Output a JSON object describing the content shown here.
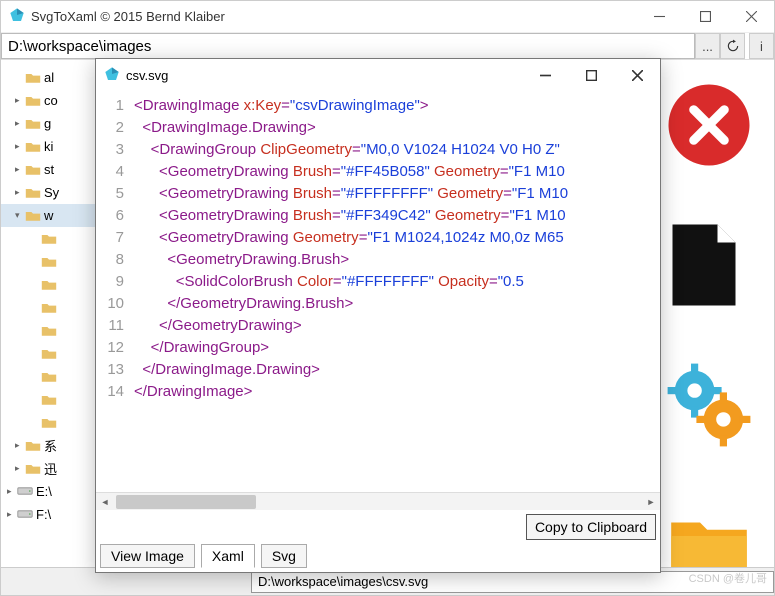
{
  "main": {
    "title": "SvgToXaml   © 2015 Bernd Klaiber",
    "path": "D:\\workspace\\images"
  },
  "toolbar": {
    "browse": "...",
    "info": "i"
  },
  "tree": {
    "items": [
      {
        "label": "al",
        "exp": false
      },
      {
        "label": "co",
        "exp": true
      },
      {
        "label": "g",
        "exp": true
      },
      {
        "label": "ki",
        "exp": true
      },
      {
        "label": "st",
        "exp": true
      },
      {
        "label": "Sy",
        "exp": true
      },
      {
        "label": "w",
        "exp": true,
        "sel": true,
        "child": true
      }
    ],
    "extra": [
      {
        "label": "系"
      },
      {
        "label": "迅"
      }
    ],
    "drives": [
      {
        "label": "E:\\"
      },
      {
        "label": "F:\\"
      }
    ]
  },
  "bottom": {
    "path": "D:\\workspace\\images\\csv.svg"
  },
  "child": {
    "title": "csv.svg",
    "copy": "Copy to Clipboard",
    "tabs": [
      "View Image",
      "Xaml",
      "Svg"
    ],
    "active_tab": 1
  },
  "code_lines": [
    [
      {
        "t": "tag",
        "s": "<DrawingImage "
      },
      {
        "t": "attr",
        "s": "x:Key"
      },
      {
        "t": "tag",
        "s": "="
      },
      {
        "t": "val",
        "s": "\"csvDrawingImage\""
      },
      {
        "t": "tag",
        "s": ">"
      }
    ],
    [
      {
        "t": "pad",
        "s": "  "
      },
      {
        "t": "tag",
        "s": "<DrawingImage.Drawing>"
      }
    ],
    [
      {
        "t": "pad",
        "s": "    "
      },
      {
        "t": "tag",
        "s": "<DrawingGroup "
      },
      {
        "t": "attr",
        "s": "ClipGeometry"
      },
      {
        "t": "tag",
        "s": "="
      },
      {
        "t": "val",
        "s": "\"M0,0 V1024 H1024 V0 H0 Z\""
      }
    ],
    [
      {
        "t": "pad",
        "s": "      "
      },
      {
        "t": "tag",
        "s": "<GeometryDrawing "
      },
      {
        "t": "attr",
        "s": "Brush"
      },
      {
        "t": "tag",
        "s": "="
      },
      {
        "t": "val",
        "s": "\"#FF45B058\" "
      },
      {
        "t": "attr",
        "s": "Geometry"
      },
      {
        "t": "tag",
        "s": "="
      },
      {
        "t": "val",
        "s": "\"F1 M10"
      }
    ],
    [
      {
        "t": "pad",
        "s": "      "
      },
      {
        "t": "tag",
        "s": "<GeometryDrawing "
      },
      {
        "t": "attr",
        "s": "Brush"
      },
      {
        "t": "tag",
        "s": "="
      },
      {
        "t": "val",
        "s": "\"#FFFFFFFF\" "
      },
      {
        "t": "attr",
        "s": "Geometry"
      },
      {
        "t": "tag",
        "s": "="
      },
      {
        "t": "val",
        "s": "\"F1 M10"
      }
    ],
    [
      {
        "t": "pad",
        "s": "      "
      },
      {
        "t": "tag",
        "s": "<GeometryDrawing "
      },
      {
        "t": "attr",
        "s": "Brush"
      },
      {
        "t": "tag",
        "s": "="
      },
      {
        "t": "val",
        "s": "\"#FF349C42\" "
      },
      {
        "t": "attr",
        "s": "Geometry"
      },
      {
        "t": "tag",
        "s": "="
      },
      {
        "t": "val",
        "s": "\"F1 M10"
      }
    ],
    [
      {
        "t": "pad",
        "s": "      "
      },
      {
        "t": "tag",
        "s": "<GeometryDrawing "
      },
      {
        "t": "attr",
        "s": "Geometry"
      },
      {
        "t": "tag",
        "s": "="
      },
      {
        "t": "val",
        "s": "\"F1 M1024,1024z M0,0z M65"
      }
    ],
    [
      {
        "t": "pad",
        "s": "        "
      },
      {
        "t": "tag",
        "s": "<GeometryDrawing.Brush>"
      }
    ],
    [
      {
        "t": "pad",
        "s": "          "
      },
      {
        "t": "tag",
        "s": "<SolidColorBrush "
      },
      {
        "t": "attr",
        "s": "Color"
      },
      {
        "t": "tag",
        "s": "="
      },
      {
        "t": "val",
        "s": "\"#FFFFFFFF\" "
      },
      {
        "t": "attr",
        "s": "Opacity"
      },
      {
        "t": "tag",
        "s": "="
      },
      {
        "t": "val",
        "s": "\"0.5"
      }
    ],
    [
      {
        "t": "pad",
        "s": "        "
      },
      {
        "t": "tag",
        "s": "</GeometryDrawing.Brush>"
      }
    ],
    [
      {
        "t": "pad",
        "s": "      "
      },
      {
        "t": "tag",
        "s": "</GeometryDrawing>"
      }
    ],
    [
      {
        "t": "pad",
        "s": "    "
      },
      {
        "t": "tag",
        "s": "</DrawingGroup>"
      }
    ],
    [
      {
        "t": "pad",
        "s": "  "
      },
      {
        "t": "tag",
        "s": "</DrawingImage.Drawing>"
      }
    ],
    [
      {
        "t": "tag",
        "s": "</DrawingImage>"
      }
    ]
  ],
  "watermark": "CSDN @卷儿哥"
}
